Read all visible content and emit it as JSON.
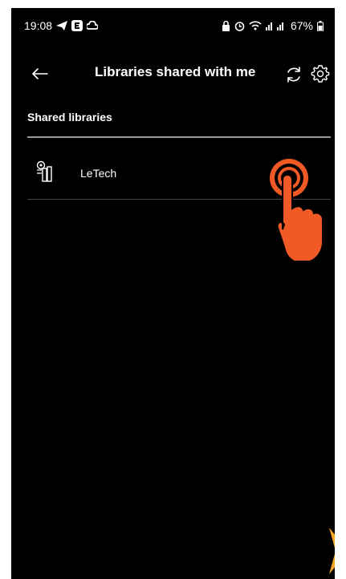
{
  "status_bar": {
    "time": "19:08",
    "battery": "67%"
  },
  "app_bar": {
    "title": "Libraries shared with me",
    "back_icon": "arrow-left-icon",
    "refresh_icon": "refresh-icon",
    "settings_icon": "gear-icon"
  },
  "section": {
    "header": "Shared libraries",
    "items": [
      {
        "name": "LeTech",
        "icon": "library-icon"
      }
    ]
  },
  "overlay": {
    "tap_icon": "tap-hand-icon",
    "next_icon": "chevron-right-icon"
  },
  "colors": {
    "background": "#000000",
    "text": "#ffffff",
    "accent": "#f15a24",
    "divider": "#9a9a9a"
  }
}
